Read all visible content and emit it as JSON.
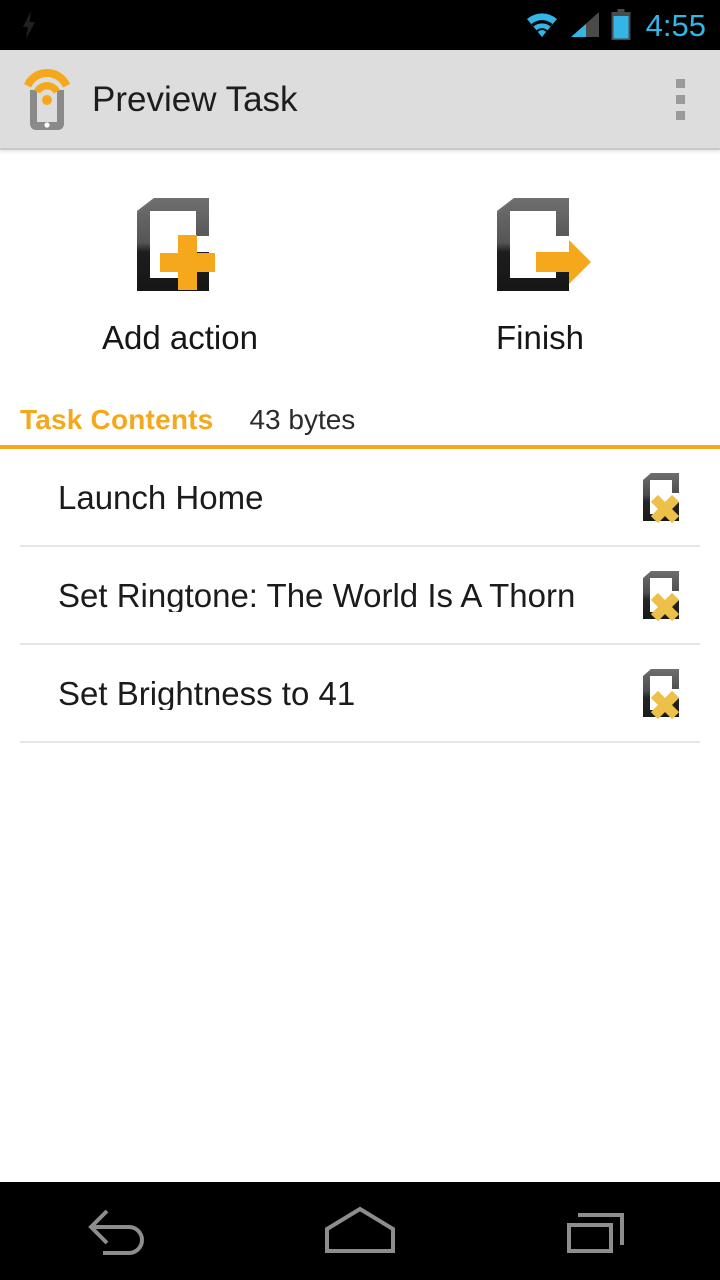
{
  "status_bar": {
    "left_icon": "lightning-bolt-icon",
    "wifi_icon": "wifi-icon",
    "signal_icon": "cellular-signal-icon",
    "battery_icon": "battery-icon",
    "clock": "4:55",
    "accent_color": "#33b5e5",
    "background": "#000000"
  },
  "action_bar": {
    "logo_icon": "tasker-app-icon",
    "title": "Preview Task",
    "overflow_icon": "overflow-menu-icon",
    "background": "#dddddd"
  },
  "quick_actions": [
    {
      "label": "Add action",
      "icon": "document-add-icon"
    },
    {
      "label": "Finish",
      "icon": "document-exit-icon"
    }
  ],
  "tab_strip": {
    "label": "Task Contents",
    "meta": "43 bytes",
    "accent_color": "#f5a81c"
  },
  "task_list": [
    {
      "name": "Launch Home",
      "delete_icon": "document-delete-icon"
    },
    {
      "name": "Set Ringtone: The World Is A Thorn",
      "delete_icon": "document-delete-icon"
    },
    {
      "name": "Set Brightness to 41",
      "delete_icon": "document-delete-icon"
    }
  ],
  "nav_bar": {
    "back": "back-icon",
    "home": "home-icon",
    "recents": "recents-icon",
    "icon_color": "#8d8d8d"
  },
  "theme": {
    "orange": "#f5a81c",
    "gold": "#edc04a",
    "text": "#1b1b1b",
    "divider": "#e6e6e6"
  }
}
